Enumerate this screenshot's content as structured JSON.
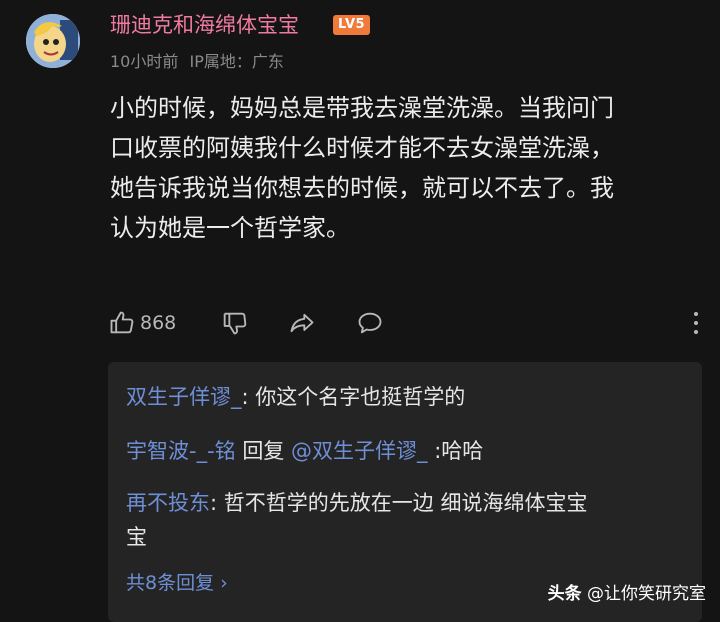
{
  "post": {
    "username": "珊迪克和海绵体宝宝",
    "level_badge": "LV5",
    "time": "10小时前",
    "ip_label": "IP属地：广东",
    "content_lines": [
      "小的时候，妈妈总是带我去澡堂洗澡。当我问门",
      "口收票的阿姨我什么时候才能不去女澡堂洗澡，",
      "她告诉我说当你想去的时候，就可以不去了。我",
      "认为她是一个哲学家。"
    ],
    "like_count": "868"
  },
  "replies": [
    {
      "author": "双生子佯谬_",
      "sep": ": ",
      "text": "你这个名字也挺哲学的"
    },
    {
      "author": "宇智波-_-铭",
      "action": " 回复 ",
      "mention": "@双生子佯谬_",
      "sep": " :",
      "text": "哈哈"
    },
    {
      "author": "再不投东",
      "sep": ": ",
      "text_line1": "哲不哲学的先放在一边 细说海绵体宝宝",
      "text_line2": "宝"
    }
  ],
  "more_replies": "共8条回复 ›",
  "watermark": {
    "brand": "头条",
    "handle": " @让你笑研究室"
  },
  "icons": [
    "thumbs-up-icon",
    "thumbs-down-icon",
    "share-icon",
    "comment-icon",
    "more-vertical-icon"
  ]
}
